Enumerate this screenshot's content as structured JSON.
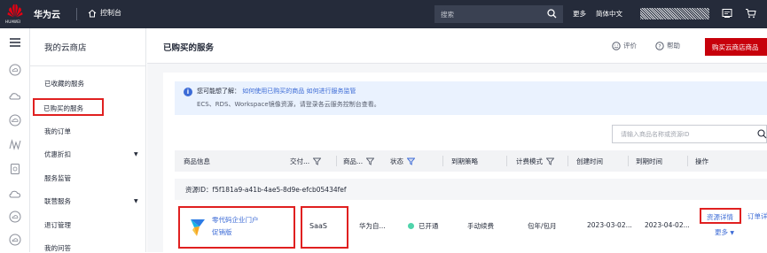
{
  "topbar": {
    "logo_text": "HUAWEI",
    "brand": "华为云",
    "console": "控制台",
    "search_placeholder": "搜索",
    "more": "更多",
    "language": "简体中文"
  },
  "sidebar": {
    "title": "我的云商店",
    "items": [
      {
        "label": "已收藏的服务"
      },
      {
        "label": "已购买的服务",
        "active": true
      },
      {
        "label": "我的订单"
      },
      {
        "label": "优惠折扣"
      },
      {
        "label": "服务监管"
      },
      {
        "label": "联营服务"
      },
      {
        "label": "退订管理"
      },
      {
        "label": "我的问答"
      }
    ]
  },
  "header": {
    "title": "已购买的服务",
    "evaluate": "评价",
    "help": "帮助",
    "buy_button": "购买云商店商品"
  },
  "notice": {
    "prefix": "您可能想了解：",
    "link1": "如何使用已购买的商品",
    "link2": "如何进行服务监管",
    "line2": "ECS、RDS、Workspace镜像资源，请登录各云服务控制台查看。"
  },
  "filter": {
    "placeholder": "请输入商品名称或资源ID"
  },
  "table": {
    "columns": [
      "商品信息",
      "交付...",
      "商品...",
      "状态",
      "到期策略",
      "计费模式",
      "创建时间",
      "到期时间",
      "操作"
    ],
    "resource_id": "资源ID：f5f181a9-a41b-4ae5-8d9e-efcb05434fef",
    "row": {
      "product_name": "零代码企业门户",
      "edition": "促销版",
      "delivery": "SaaS",
      "merchant": "华为自...",
      "status": "已开通",
      "expiry_policy": "手动续费",
      "billing": "包年/包月",
      "created": "2023-03-02...",
      "expires": "2023-04-02...",
      "action_detail": "资源详情",
      "action_order": "订单详情",
      "action_more": "更多"
    }
  },
  "colors": {
    "topbar": "#252b3a",
    "accent_red": "#c7000b",
    "highlight": "#e02020",
    "link": "#3c6bd6",
    "status_green": "#50d4ab"
  }
}
